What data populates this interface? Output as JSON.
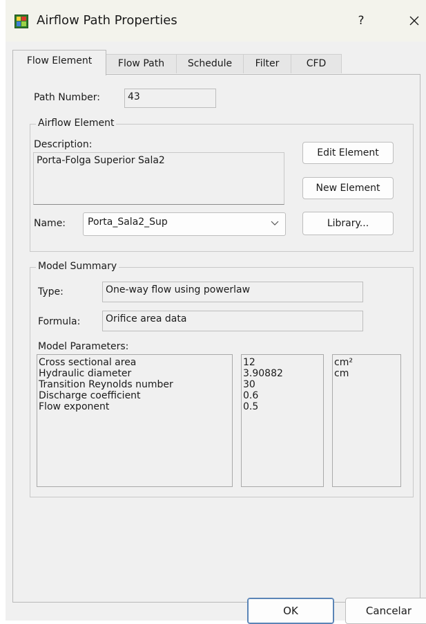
{
  "window": {
    "title": "Airflow Path Properties",
    "help_label": "?",
    "close_label": "✕"
  },
  "tabs": [
    {
      "label": "Flow Element",
      "active": true
    },
    {
      "label": "Flow Path",
      "active": false
    },
    {
      "label": "Schedule",
      "active": false
    },
    {
      "label": "Filter",
      "active": false
    },
    {
      "label": "CFD",
      "active": false
    }
  ],
  "path_number": {
    "label": "Path Number:",
    "value": "43"
  },
  "airflow_element": {
    "group_label": "Airflow Element",
    "description_label": "Description:",
    "description_value": "Porta-Folga Superior Sala2",
    "name_label": "Name:",
    "name_value": "Porta_Sala2_Sup",
    "edit_button": "Edit Element",
    "new_button": "New Element",
    "library_button": "Library..."
  },
  "model_summary": {
    "group_label": "Model Summary",
    "type_label": "Type:",
    "type_value": "One-way flow using powerlaw",
    "formula_label": "Formula:",
    "formula_value": "Orifice area data",
    "parameters_label": "Model Parameters:",
    "parameters": [
      {
        "name": "Cross sectional area",
        "value": "12",
        "unit": "cm²"
      },
      {
        "name": "Hydraulic diameter",
        "value": "3.90882",
        "unit": "cm"
      },
      {
        "name": "Transition Reynolds number",
        "value": "30",
        "unit": ""
      },
      {
        "name": "Discharge coefficient",
        "value": "0.6",
        "unit": ""
      },
      {
        "name": "Flow exponent",
        "value": "0.5",
        "unit": ""
      }
    ]
  },
  "footer": {
    "ok_label": "OK",
    "cancel_label": "Cancelar"
  },
  "colors": {
    "titlebar_bg": "#f3f3ec",
    "dialog_bg": "#f0f0f0",
    "ok_border": "#5a84b6"
  },
  "icons": {
    "app": "airflow-app-icon",
    "chevron": "chevron-down-icon"
  }
}
